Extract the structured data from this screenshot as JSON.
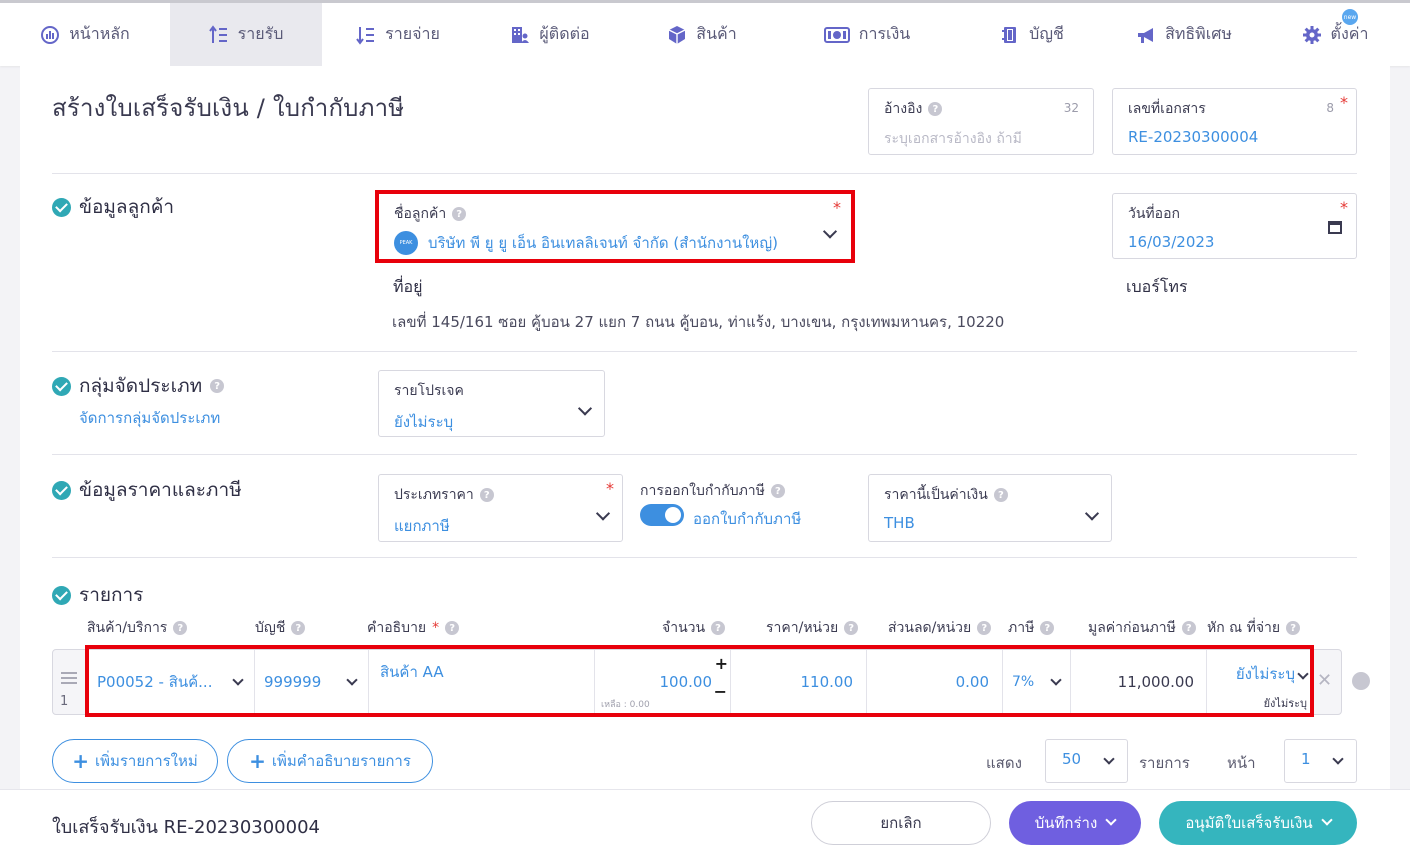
{
  "nav": [
    {
      "label": "หน้าหลัก",
      "icon": "dashboard-icon"
    },
    {
      "label": "รายรับ",
      "icon": "income-icon"
    },
    {
      "label": "รายจ่าย",
      "icon": "expense-icon"
    },
    {
      "label": "ผู้ติดต่อ",
      "icon": "contacts-icon"
    },
    {
      "label": "สินค้า",
      "icon": "product-box-icon"
    },
    {
      "label": "การเงิน",
      "icon": "money-icon"
    },
    {
      "label": "บัญชี",
      "icon": "ledger-icon"
    },
    {
      "label": "สิทธิพิเศษ",
      "icon": "megaphone-icon"
    },
    {
      "label": "ตั้งค่า",
      "icon": "gear-icon",
      "badge": "new"
    }
  ],
  "page": {
    "title": "สร้างใบเสร็จรับเงิน / ใบกำกับภาษี",
    "reference": {
      "label": "อ้างอิง",
      "placeholder": "ระบุเอกสารอ้างอิง ถ้ามี",
      "counter": "32"
    },
    "doc_number": {
      "label": "เลขที่เอกสาร",
      "value": "RE-20230300004",
      "counter": "8"
    }
  },
  "customer": {
    "section_title": "ข้อมูลลูกค้า",
    "name_label": "ชื่อลูกค้า",
    "name_value": "บริษัท พี ยู ยู เอ็น อินเทลลิเจนท์ จำกัด (สำนักงานใหญ่)",
    "logo_text": "PEAK",
    "address_label": "ที่อยู่",
    "address_value": "เลขที่ 145/161 ซอย คู้บอน 27 แยก 7 ถนน คู้บอน, ท่าแร้ง, บางเขน, กรุงเทพมหานคร, 10220",
    "date_label": "วันที่ออก",
    "date_value": "16/03/2023",
    "phone_label": "เบอร์โทร"
  },
  "category": {
    "section_title": "กลุ่มจัดประเภท",
    "manage_link": "จัดการกลุ่มจัดประเภท",
    "project_label": "รายโปรเจค",
    "project_value": "ยังไม่ระบุ"
  },
  "pricing": {
    "section_title": "ข้อมูลราคาและภาษี",
    "price_type_label": "ประเภทราคา",
    "price_type_value": "แยกภาษี",
    "tax_invoice_label": "การออกใบกำกับภาษี",
    "tax_invoice_toggle_label": "ออกใบกำกับภาษี",
    "tax_invoice_on": true,
    "currency_label": "ราคานี้เป็นค่าเงิน",
    "currency_value": "THB"
  },
  "items": {
    "section_title": "รายการ",
    "headers": {
      "product": "สินค้า/บริการ",
      "account": "บัญชี",
      "description": "คำอธิบาย",
      "quantity": "จำนวน",
      "unit_price": "ราคา/หน่วย",
      "discount": "ส่วนลด/หน่วย",
      "tax": "ภาษี",
      "pretax": "มูลค่าก่อนภาษี",
      "withholding": "หัก ณ ที่จ่าย"
    },
    "rows": [
      {
        "num": "1",
        "product": "P00052 - สินค้...",
        "account": "999999",
        "description": "สินค้า AA",
        "quantity": "100.00",
        "remaining": "เหลือ : 0.00",
        "unit_price": "110.00",
        "discount": "0.00",
        "tax": "7%",
        "pretax": "11,000.00",
        "withholding": "ยังไม่ระบุ",
        "withholding_sub": "ยังไม่ระบุ"
      }
    ],
    "add_item_button": "เพิ่มรายการใหม่",
    "add_description_button": "เพิ่มคำอธิบายรายการ",
    "show_label": "แสดง",
    "page_size": "50",
    "items_label": "รายการ",
    "page_label": "หน้า",
    "page_number": "1"
  },
  "footer": {
    "title": "ใบเสร็จรับเงิน RE-20230300004",
    "cancel": "ยกเลิก",
    "save_draft": "บันทึกร่าง",
    "approve": "อนุมัติใบเสร็จรับเงิน"
  },
  "colors": {
    "accent_blue": "#3d8fe0",
    "draft_purple": "#6f5fe0",
    "approve_teal": "#35b5be",
    "highlight_red": "#e8000b"
  }
}
